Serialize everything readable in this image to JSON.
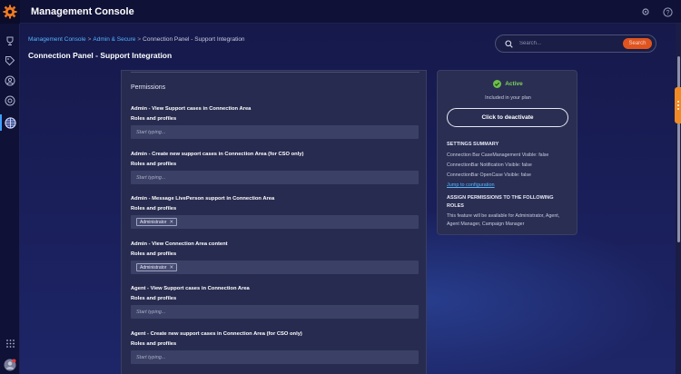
{
  "app": {
    "title": "Management Console"
  },
  "topbar": {
    "icons": [
      "settings-icon",
      "help-icon"
    ]
  },
  "sidebar": {
    "icons": [
      "trophy-icon",
      "tag-icon",
      "user-icon",
      "dashboard-icon",
      "globe-icon"
    ],
    "bottom_icons": [
      "apps-grid-icon",
      "avatar"
    ]
  },
  "breadcrumb": {
    "items": [
      "Management Console",
      "Admin & Secure",
      "Connection Panel - Support Integration"
    ],
    "separator": ">"
  },
  "page": {
    "title": "Connection Panel - Support Integration"
  },
  "search": {
    "placeholder": "Search...",
    "button_label": "Search"
  },
  "permissions": {
    "title": "Permissions",
    "roles_label": "Roles and profiles",
    "placeholder": "Start typing...",
    "items": [
      {
        "label": "Admin - View Support cases in Connection Area",
        "chip": ""
      },
      {
        "label": "Admin - Create new support cases in Connection Area (for CSO only)",
        "chip": ""
      },
      {
        "label": "Admin - Message LivePerson support in Connection Area",
        "chip": "Administrator"
      },
      {
        "label": "Admin - View Connection Area content",
        "chip": "Administrator"
      },
      {
        "label": "Agent - View Support cases in Connection Area",
        "chip": ""
      },
      {
        "label": "Agent - Create new support cases in Connection Area (for CSO only)",
        "chip": ""
      }
    ]
  },
  "status_panel": {
    "status": "Active",
    "plan_note": "Included in your plan",
    "deactivate_label": "Click to deactivate",
    "settings_heading": "SETTINGS SUMMARY",
    "settings": [
      "Connection Bar CaseManagement Visible: false",
      "ConnectionBar Notification Visible: false",
      "ConnectionBar OpenCase Visible: false"
    ],
    "config_link": "Jump to configuration",
    "assign_heading": "ASSIGN PERMISSIONS TO THE FOLLOWING ROLES",
    "assign_text": "This feature will be available for Administrator, Agent, Agent Manager, Campaign Manager"
  },
  "colors": {
    "accent_blue": "#55b4ff",
    "search_button": "#e0541f",
    "active_green": "#7fd45c",
    "side_tab": "#f08a24"
  }
}
